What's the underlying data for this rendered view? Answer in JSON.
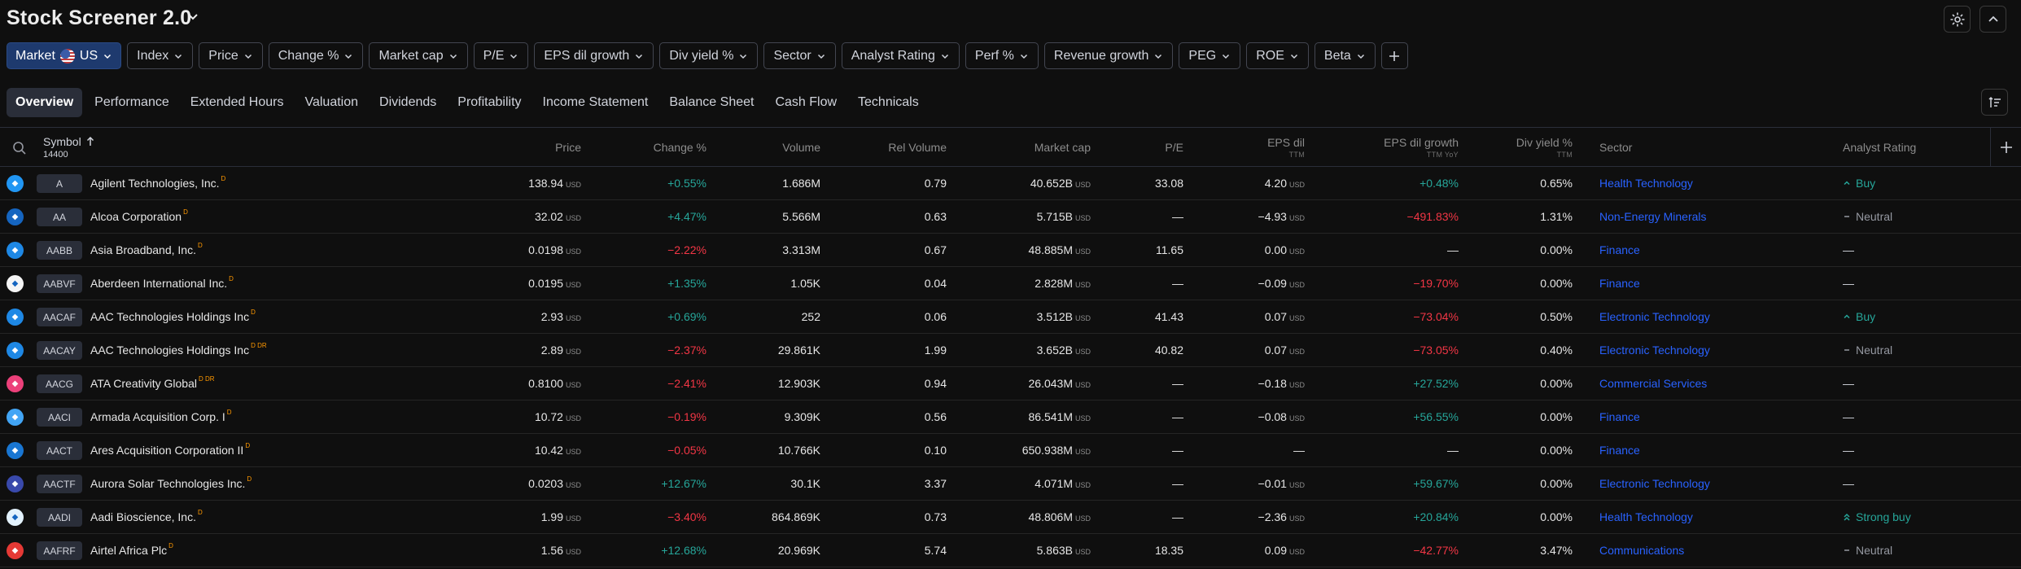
{
  "app": {
    "title": "Stock Screener 2.0"
  },
  "filters": [
    {
      "label": "Index"
    },
    {
      "label": "Price"
    },
    {
      "label": "Change %"
    },
    {
      "label": "Market cap"
    },
    {
      "label": "P/E"
    },
    {
      "label": "EPS dil growth"
    },
    {
      "label": "Div yield %"
    },
    {
      "label": "Sector"
    },
    {
      "label": "Analyst Rating"
    },
    {
      "label": "Perf %"
    },
    {
      "label": "Revenue growth"
    },
    {
      "label": "PEG"
    },
    {
      "label": "ROE"
    },
    {
      "label": "Beta"
    }
  ],
  "market_filter": {
    "label": "Market",
    "value": "US"
  },
  "tabs": [
    {
      "label": "Overview",
      "active": true
    },
    {
      "label": "Performance"
    },
    {
      "label": "Extended Hours"
    },
    {
      "label": "Valuation"
    },
    {
      "label": "Dividends"
    },
    {
      "label": "Profitability"
    },
    {
      "label": "Income Statement"
    },
    {
      "label": "Balance Sheet"
    },
    {
      "label": "Cash Flow"
    },
    {
      "label": "Technicals"
    }
  ],
  "table": {
    "headers": {
      "symbol": "Symbol",
      "symbol_count": "14400",
      "price": "Price",
      "change": "Change %",
      "volume": "Volume",
      "rel_volume": "Rel Volume",
      "market_cap": "Market cap",
      "pe": "P/E",
      "eps": "EPS dil",
      "eps_sub": "TTM",
      "eps_growth": "EPS dil growth",
      "eps_growth_sub": "TTM YoY",
      "div_yield": "Div yield %",
      "div_yield_sub": "TTM",
      "sector": "Sector",
      "analyst": "Analyst Rating"
    },
    "currency": "USD",
    "rows": [
      {
        "ticker": "A",
        "name": "Agilent Technologies, Inc.",
        "sup": "D",
        "logo_color": "#2196f3",
        "price": "138.94",
        "change": "+0.55%",
        "change_dir": "pos",
        "volume": "1.686M",
        "rel_volume": "0.79",
        "market_cap": "40.652B",
        "pe": "33.08",
        "eps": "4.20",
        "eps_unit": true,
        "eps_growth": "+0.48%",
        "eps_growth_dir": "pos",
        "div_yield": "0.65%",
        "sector": "Health Technology",
        "rating": "Buy",
        "rating_type": "buy"
      },
      {
        "ticker": "AA",
        "name": "Alcoa Corporation",
        "sup": "D",
        "logo_color": "#1565c0",
        "price": "32.02",
        "change": "+4.47%",
        "change_dir": "pos",
        "volume": "5.566M",
        "rel_volume": "0.63",
        "market_cap": "5.715B",
        "pe": "—",
        "eps": "−4.93",
        "eps_unit": true,
        "eps_growth": "−491.83%",
        "eps_growth_dir": "neg",
        "div_yield": "1.31%",
        "sector": "Non-Energy Minerals",
        "rating": "Neutral",
        "rating_type": "neutral"
      },
      {
        "ticker": "AABB",
        "name": "Asia Broadband, Inc.",
        "sup": "D",
        "logo_color": "#1e88e5",
        "price": "0.0198",
        "change": "−2.22%",
        "change_dir": "neg",
        "volume": "3.313M",
        "rel_volume": "0.67",
        "market_cap": "48.885M",
        "pe": "11.65",
        "eps": "0.00",
        "eps_unit": true,
        "eps_growth": "—",
        "eps_growth_dir": "none",
        "div_yield": "0.00%",
        "sector": "Finance",
        "rating": "—",
        "rating_type": "none"
      },
      {
        "ticker": "AABVF",
        "name": "Aberdeen International Inc.",
        "sup": "D",
        "logo_color": "#f5f5f5",
        "price": "0.0195",
        "change": "+1.35%",
        "change_dir": "pos",
        "volume": "1.05K",
        "rel_volume": "0.04",
        "market_cap": "2.828M",
        "pe": "—",
        "eps": "−0.09",
        "eps_unit": true,
        "eps_growth": "−19.70%",
        "eps_growth_dir": "neg",
        "div_yield": "0.00%",
        "sector": "Finance",
        "rating": "—",
        "rating_type": "none"
      },
      {
        "ticker": "AACAF",
        "name": "AAC Technologies Holdings Inc",
        "sup": "D",
        "logo_color": "#1e88e5",
        "price": "2.93",
        "change": "+0.69%",
        "change_dir": "pos",
        "volume": "252",
        "rel_volume": "0.06",
        "market_cap": "3.512B",
        "pe": "41.43",
        "eps": "0.07",
        "eps_unit": true,
        "eps_growth": "−73.04%",
        "eps_growth_dir": "neg",
        "div_yield": "0.50%",
        "sector": "Electronic Technology",
        "rating": "Buy",
        "rating_type": "buy"
      },
      {
        "ticker": "AACAY",
        "name": "AAC Technologies Holdings Inc",
        "sup": "D DR",
        "logo_color": "#1e88e5",
        "price": "2.89",
        "change": "−2.37%",
        "change_dir": "neg",
        "volume": "29.861K",
        "rel_volume": "1.99",
        "market_cap": "3.652B",
        "pe": "40.82",
        "eps": "0.07",
        "eps_unit": true,
        "eps_growth": "−73.05%",
        "eps_growth_dir": "neg",
        "div_yield": "0.40%",
        "sector": "Electronic Technology",
        "rating": "Neutral",
        "rating_type": "neutral"
      },
      {
        "ticker": "AACG",
        "name": "ATA Creativity Global",
        "sup": "D DR",
        "logo_color": "#ec407a",
        "price": "0.8100",
        "change": "−2.41%",
        "change_dir": "neg",
        "volume": "12.903K",
        "rel_volume": "0.94",
        "market_cap": "26.043M",
        "pe": "—",
        "eps": "−0.18",
        "eps_unit": true,
        "eps_growth": "+27.52%",
        "eps_growth_dir": "pos",
        "div_yield": "0.00%",
        "sector": "Commercial Services",
        "rating": "—",
        "rating_type": "none"
      },
      {
        "ticker": "AACI",
        "name": "Armada Acquisition Corp. I",
        "sup": "D",
        "logo_color": "#42a5f5",
        "price": "10.72",
        "change": "−0.19%",
        "change_dir": "neg",
        "volume": "9.309K",
        "rel_volume": "0.56",
        "market_cap": "86.541M",
        "pe": "—",
        "eps": "−0.08",
        "eps_unit": true,
        "eps_growth": "+56.55%",
        "eps_growth_dir": "pos",
        "div_yield": "0.00%",
        "sector": "Finance",
        "rating": "—",
        "rating_type": "none"
      },
      {
        "ticker": "AACT",
        "name": "Ares Acquisition Corporation II",
        "sup": "D",
        "logo_color": "#1976d2",
        "price": "10.42",
        "change": "−0.05%",
        "change_dir": "neg",
        "volume": "10.766K",
        "rel_volume": "0.10",
        "market_cap": "650.938M",
        "pe": "—",
        "eps": "—",
        "eps_unit": false,
        "eps_growth": "—",
        "eps_growth_dir": "none",
        "div_yield": "0.00%",
        "sector": "Finance",
        "rating": "—",
        "rating_type": "none"
      },
      {
        "ticker": "AACTF",
        "name": "Aurora Solar Technologies Inc.",
        "sup": "D",
        "logo_color": "#3949ab",
        "price": "0.0203",
        "change": "+12.67%",
        "change_dir": "pos",
        "volume": "30.1K",
        "rel_volume": "3.37",
        "market_cap": "4.071M",
        "pe": "—",
        "eps": "−0.01",
        "eps_unit": true,
        "eps_growth": "+59.67%",
        "eps_growth_dir": "pos",
        "div_yield": "0.00%",
        "sector": "Electronic Technology",
        "rating": "—",
        "rating_type": "none"
      },
      {
        "ticker": "AADI",
        "name": "Aadi Bioscience, Inc.",
        "sup": "D",
        "logo_color": "#e3f2fd",
        "price": "1.99",
        "change": "−3.40%",
        "change_dir": "neg",
        "volume": "864.869K",
        "rel_volume": "0.73",
        "market_cap": "48.806M",
        "pe": "—",
        "eps": "−2.36",
        "eps_unit": true,
        "eps_growth": "+20.84%",
        "eps_growth_dir": "pos",
        "div_yield": "0.00%",
        "sector": "Health Technology",
        "rating": "Strong buy",
        "rating_type": "strongbuy"
      },
      {
        "ticker": "AAFRF",
        "name": "Airtel Africa Plc",
        "sup": "D",
        "logo_color": "#e53935",
        "price": "1.56",
        "change": "+12.68%",
        "change_dir": "pos",
        "volume": "20.969K",
        "rel_volume": "5.74",
        "market_cap": "5.863B",
        "pe": "18.35",
        "eps": "0.09",
        "eps_unit": true,
        "eps_growth": "−42.77%",
        "eps_growth_dir": "neg",
        "div_yield": "3.47%",
        "sector": "Communications",
        "rating": "Neutral",
        "rating_type": "neutral"
      }
    ]
  }
}
